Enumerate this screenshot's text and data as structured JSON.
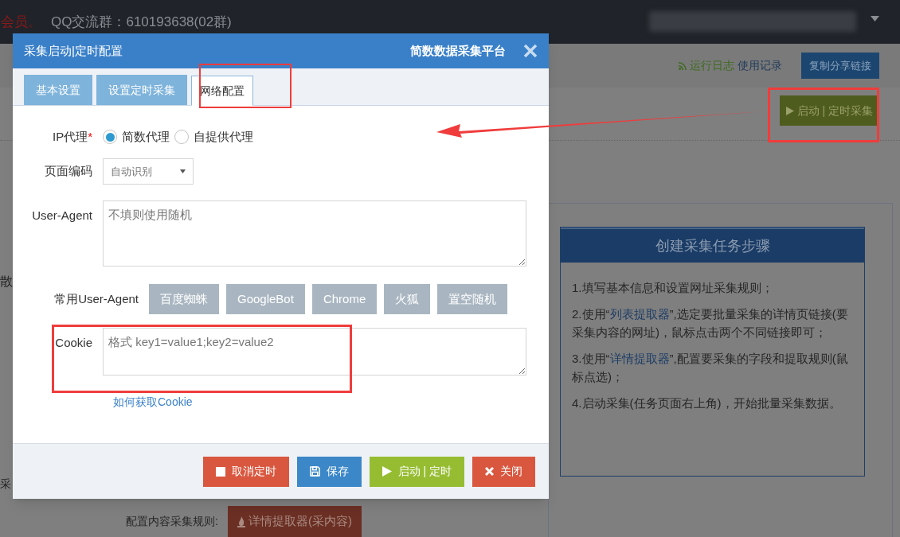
{
  "top_bar": {
    "notice": "会员。",
    "qq_group": "QQ交流群：610193638(02群)"
  },
  "toolbar": {
    "log_link": "运行日志",
    "history_link": "使用记录",
    "share_button": "复制分享链接",
    "start_button": "启动 | 定时采集"
  },
  "left_fragments": [
    "散",
    "采"
  ],
  "steps_panel": {
    "title": "创建采集任务步骤",
    "steps": [
      [
        {
          "text": "1.填写基本信息和设置网址采集规则；",
          "highlight": false
        }
      ],
      [
        {
          "text": "2.使用“",
          "highlight": false
        },
        {
          "text": "列表提取器",
          "highlight": true
        },
        {
          "text": "”,选定要批量采集的详情页链接(要采集内容的网址)，鼠标点击两个不同链接即可；",
          "highlight": false
        }
      ],
      [
        {
          "text": "3.使用“",
          "highlight": false
        },
        {
          "text": "详情提取器",
          "highlight": true
        },
        {
          "text": "”,配置要采集的字段和提取规则(鼠标点选)；",
          "highlight": false
        }
      ],
      [
        {
          "text": "4.启动采集(任务页面右上角)，开始批量采集数据。",
          "highlight": false
        }
      ]
    ]
  },
  "bottom": {
    "label": "配置内容采集规则:",
    "button": "详情提取器(采内容)"
  },
  "dialog": {
    "title": "采集启动|定时配置",
    "brand": "简数数据采集平台",
    "tabs": [
      {
        "label": "基本设置",
        "selected": false
      },
      {
        "label": "设置定时采集",
        "selected": false
      },
      {
        "label": "网络配置",
        "selected": true
      }
    ],
    "proxy": {
      "label": "IP代理",
      "required_mark": "*",
      "options": [
        {
          "label": "简数代理",
          "selected": true
        },
        {
          "label": "自提供代理",
          "selected": false
        }
      ]
    },
    "encoding": {
      "label": "页面编码",
      "value": "自动识别"
    },
    "user_agent": {
      "label": "User-Agent",
      "placeholder": "不填则使用随机"
    },
    "common_ua": {
      "label": "常用User-Agent",
      "buttons": [
        "百度蜘蛛",
        "GoogleBot",
        "Chrome",
        "火狐",
        "置空随机"
      ]
    },
    "cookie": {
      "label": "Cookie",
      "placeholder": "格式 key1=value1;key2=value2"
    },
    "cookie_help": "如何获取Cookie",
    "buttons": [
      {
        "label": "取消定时",
        "kind": "cancel"
      },
      {
        "label": "保存",
        "kind": "save"
      },
      {
        "label": "启动 | 定时",
        "kind": "start"
      },
      {
        "label": "关闭",
        "kind": "close"
      }
    ]
  }
}
